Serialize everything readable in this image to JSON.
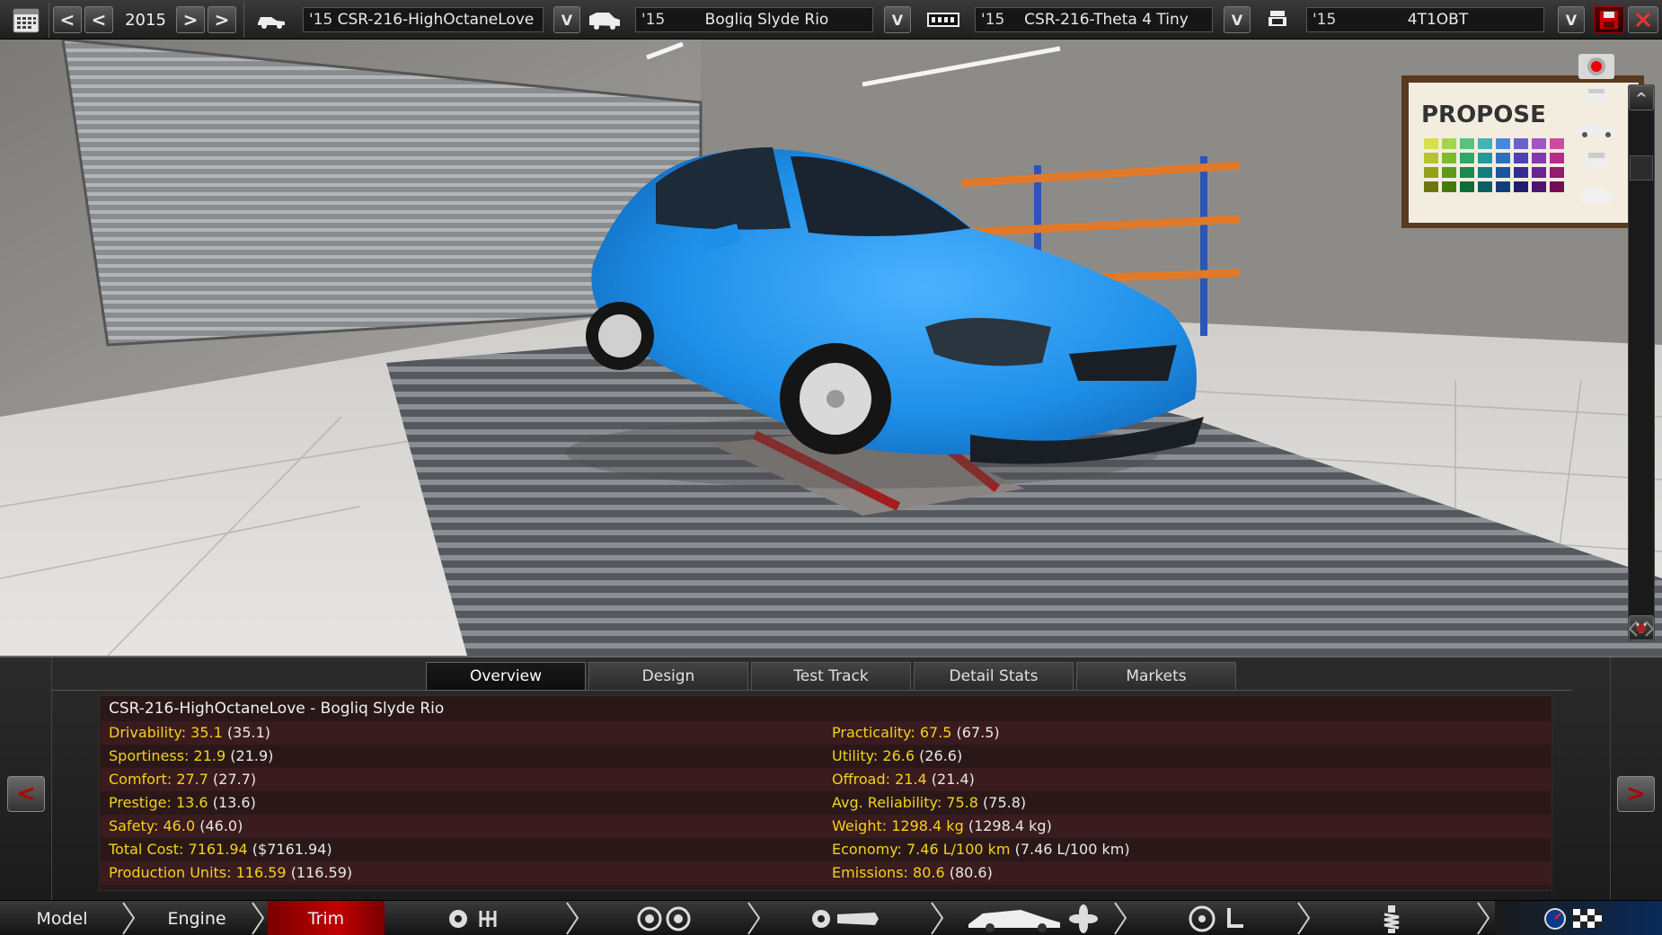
{
  "topbar": {
    "calendar_icon": "calendar-icon",
    "prev_fast": "<",
    "prev": "<",
    "year": "2015",
    "next": ">",
    "next_fast": ">",
    "model_year": "'15",
    "model_name": "CSR-216-HighOctaneLove",
    "body_year": "'15",
    "body_name": "Bogliq Slyde Rio",
    "engine_year": "'15",
    "engine_name": "CSR-216-Theta 4 Tiny",
    "trim_year": "'15",
    "trim_name": "4T1OBT",
    "dropdown_label": "V"
  },
  "sidebar": {
    "up": "^",
    "down": "V"
  },
  "tabs": [
    {
      "label": "Overview",
      "active": true
    },
    {
      "label": "Design",
      "active": false
    },
    {
      "label": "Test Track",
      "active": false
    },
    {
      "label": "Detail Stats",
      "active": false
    },
    {
      "label": "Markets",
      "active": false
    }
  ],
  "panel": {
    "prev_arrow": "<",
    "next_arrow": ">",
    "title": "CSR-216-HighOctaneLove - Bogliq Slyde Rio"
  },
  "stats_left": [
    {
      "label": "Drivability:",
      "value": "35.1",
      "base": "(35.1)"
    },
    {
      "label": "Sportiness:",
      "value": "21.9",
      "base": "(21.9)"
    },
    {
      "label": "Comfort:",
      "value": "27.7",
      "base": "(27.7)"
    },
    {
      "label": "Prestige:",
      "value": "13.6",
      "base": "(13.6)"
    },
    {
      "label": "Safety:",
      "value": "46.0",
      "base": "(46.0)"
    },
    {
      "label": "Total Cost:",
      "value": "7161.94",
      "base": "($7161.94)"
    },
    {
      "label": "Production Units:",
      "value": "116.59",
      "base": "(116.59)"
    }
  ],
  "stats_right": [
    {
      "label": "Practicality:",
      "value": "67.5",
      "base": "(67.5)"
    },
    {
      "label": "Utility:",
      "value": "26.6",
      "base": "(26.6)"
    },
    {
      "label": "Offroad:",
      "value": "21.4",
      "base": "(21.4)"
    },
    {
      "label": "Avg. Reliability:",
      "value": "75.8",
      "base": "(75.8)"
    },
    {
      "label": "Weight:",
      "value": "1298.4 kg",
      "base": "(1298.4 kg)"
    },
    {
      "label": "Economy:",
      "value": "7.46 L/100 km",
      "base": "(7.46 L/100 km)"
    },
    {
      "label": "Emissions:",
      "value": "80.6",
      "base": "(80.6)"
    }
  ],
  "bottomnav": {
    "model": "Model",
    "engine": "Engine",
    "trim": "Trim"
  },
  "scene": {
    "sign_text": "PROPOSE",
    "car_color": "#1e8fe8",
    "accent": "#c00000",
    "stat_color": "#f3d21b"
  }
}
